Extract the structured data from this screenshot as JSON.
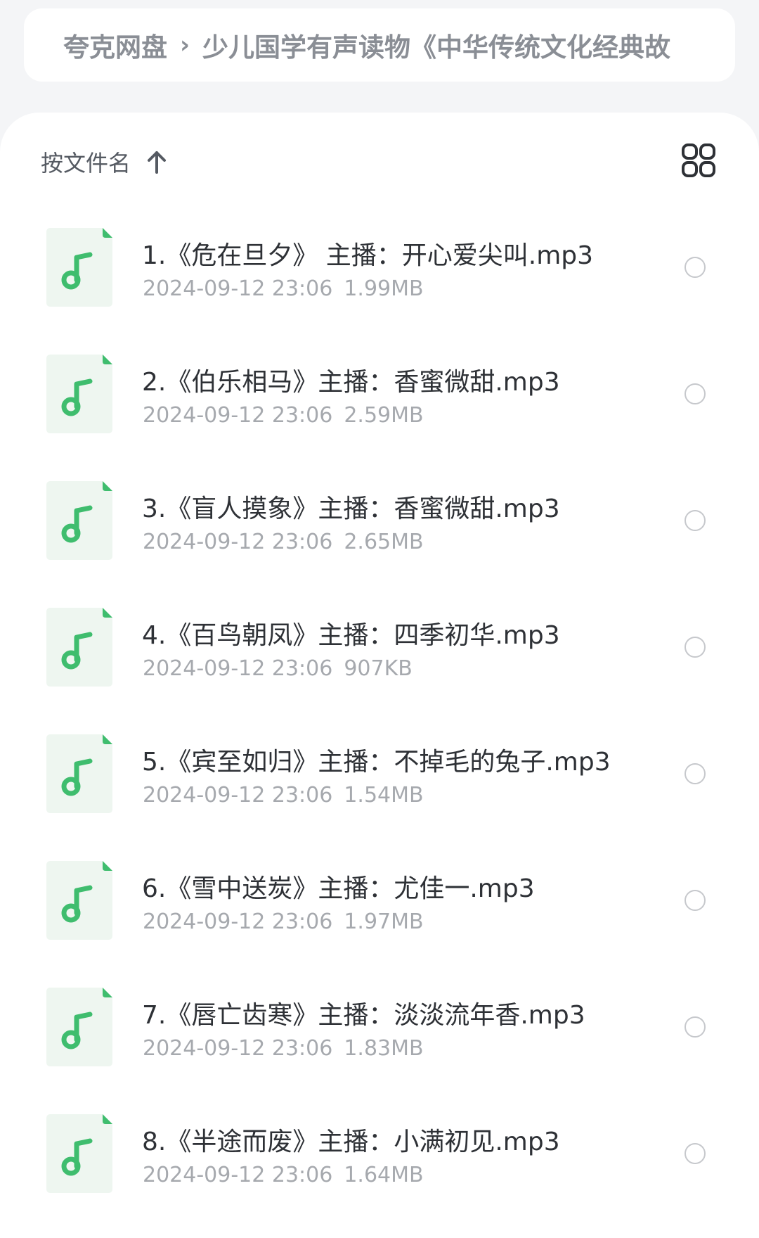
{
  "breadcrumb": {
    "root": "夸克网盘",
    "separator": "›",
    "folder": "少儿国学有声读物《中华传统文化经典故"
  },
  "sort": {
    "label": "按文件名",
    "direction_icon": "arrow-up-icon"
  },
  "view_toggle_icon": "grid-view-icon",
  "file_icon": "music-file-icon",
  "colors": {
    "accent_green": "#3fbd6e",
    "icon_bg": "#eef6f0",
    "text_primary": "#2e3136",
    "text_secondary": "#a6a9ae"
  },
  "files": [
    {
      "name": "1.《危在旦夕》 主播：开心爱尖叫.mp3",
      "date": "2024-09-12 23:06",
      "size": "1.99MB"
    },
    {
      "name": "2.《伯乐相马》主播：香蜜微甜.mp3",
      "date": "2024-09-12 23:06",
      "size": "2.59MB"
    },
    {
      "name": "3.《盲人摸象》主播：香蜜微甜.mp3",
      "date": "2024-09-12 23:06",
      "size": "2.65MB"
    },
    {
      "name": "4.《百鸟朝凤》主播：四季初华.mp3",
      "date": "2024-09-12 23:06",
      "size": "907KB"
    },
    {
      "name": "5.《宾至如归》主播：不掉毛的兔子.mp3",
      "date": "2024-09-12 23:06",
      "size": "1.54MB"
    },
    {
      "name": "6.《雪中送炭》主播：尤佳一.mp3",
      "date": "2024-09-12 23:06",
      "size": "1.97MB"
    },
    {
      "name": "7.《唇亡齿寒》主播：淡淡流年香.mp3",
      "date": "2024-09-12 23:06",
      "size": "1.83MB"
    },
    {
      "name": "8.《半途而废》主播：小满初见.mp3",
      "date": "2024-09-12 23:06",
      "size": "1.64MB"
    }
  ]
}
